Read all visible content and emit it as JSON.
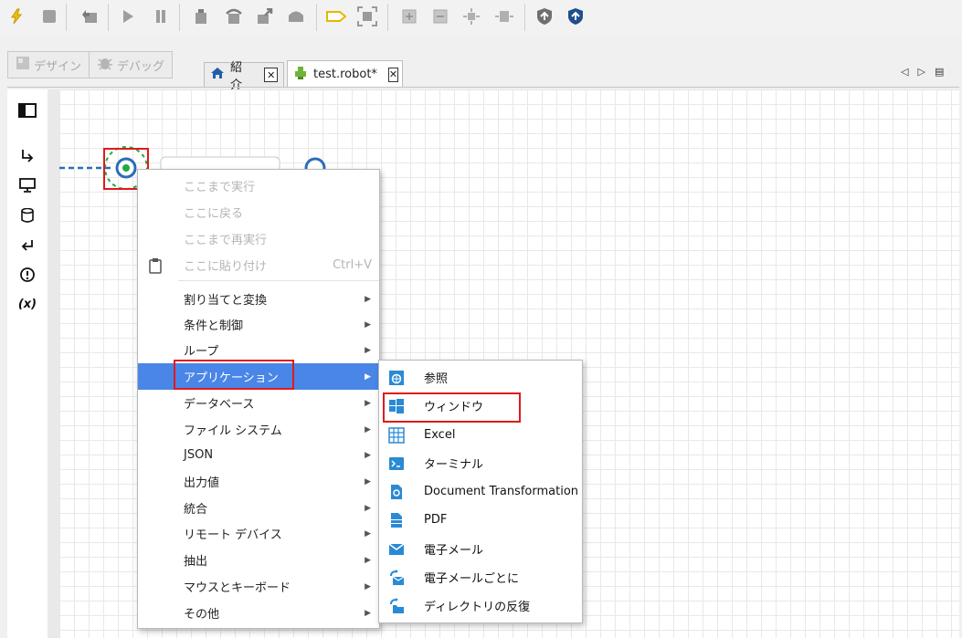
{
  "toolbar": {
    "icons": [
      "lightning-icon",
      "stop-icon",
      "reset-icon",
      "run-icon",
      "pause-icon",
      "step-into-icon",
      "step-over-icon",
      "step-out-icon",
      "step-return-icon",
      "breakpoint-tag-icon",
      "capture-icon",
      "zoom-in-icon",
      "zoom-out-icon",
      "fit-icon",
      "expand-icon",
      "publish-icon",
      "upload-icon"
    ]
  },
  "mode": {
    "design_label": "デザイン",
    "debug_label": "デバッグ"
  },
  "tabs": [
    {
      "label": "紹介",
      "icon": "home-icon",
      "active": false
    },
    {
      "label": "test.robot*",
      "icon": "robot-icon",
      "active": true
    }
  ],
  "palette": [
    "panel-toggle-icon",
    "next-step-icon",
    "screen-icon",
    "database-icon",
    "return-icon",
    "exception-icon",
    "variable-icon"
  ],
  "palette_variable_text": "(x)",
  "context_menu": {
    "items": [
      {
        "label": "ここまで実行",
        "disabled": true
      },
      {
        "label": "ここに戻る",
        "disabled": true
      },
      {
        "label": "ここまで再実行",
        "disabled": true
      },
      {
        "label": "ここに貼り付け",
        "disabled": true,
        "shortcut": "Ctrl+V",
        "icon": "clipboard-icon"
      },
      {
        "label": "割り当てと変換",
        "submenu": true
      },
      {
        "label": "条件と制御",
        "submenu": true
      },
      {
        "label": "ループ",
        "submenu": true
      },
      {
        "label": "アプリケーション",
        "submenu": true,
        "highlighted": true
      },
      {
        "label": "データベース",
        "submenu": true
      },
      {
        "label": "ファイル システム",
        "submenu": true
      },
      {
        "label": "JSON",
        "submenu": true
      },
      {
        "label": "出力値",
        "submenu": true
      },
      {
        "label": "統合",
        "submenu": true
      },
      {
        "label": "リモート デバイス",
        "submenu": true
      },
      {
        "label": "抽出",
        "submenu": true
      },
      {
        "label": "マウスとキーボード",
        "submenu": true
      },
      {
        "label": "その他",
        "submenu": true
      }
    ]
  },
  "submenu": {
    "items": [
      {
        "label": "参照",
        "icon": "browser-icon"
      },
      {
        "label": "ウィンドウ",
        "icon": "windows-icon"
      },
      {
        "label": "Excel",
        "icon": "excel-grid-icon"
      },
      {
        "label": "ターミナル",
        "icon": "terminal-icon"
      },
      {
        "label": "Document Transformation",
        "icon": "document-transform-icon"
      },
      {
        "label": "PDF",
        "icon": "pdf-icon"
      },
      {
        "label": "電子メール",
        "icon": "email-icon"
      },
      {
        "label": "電子メールごとに",
        "icon": "email-loop-icon"
      },
      {
        "label": "ディレクトリの反復",
        "icon": "directory-loop-icon"
      }
    ]
  },
  "colors": {
    "accent": "#4a86e8",
    "highlight_box": "#e01a1a",
    "node_blue": "#2b6cb8",
    "node_green": "#22aa44"
  }
}
